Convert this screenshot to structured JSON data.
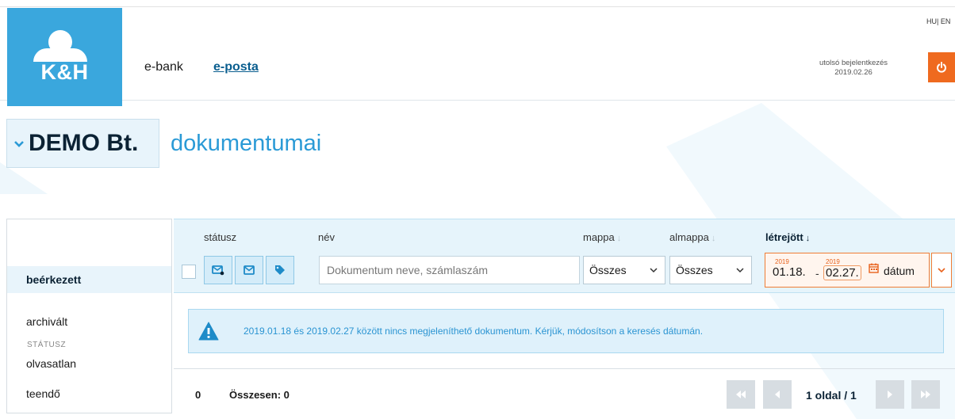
{
  "header": {
    "brand": "K&H",
    "nav": {
      "ebank": "e-bank",
      "eposta": "e-posta"
    },
    "lang": "HU| EN",
    "last_login_label": "utolsó bejelentkezés",
    "last_login_date": "2019.02.26"
  },
  "title": {
    "company": "DEMO Bt.",
    "suffix": "dokumentumai"
  },
  "sidebar": {
    "items": [
      {
        "label": "beérkezett",
        "active": true
      },
      {
        "label": "archivált",
        "active": false
      }
    ],
    "section_label": "STÁTUSZ",
    "status_items": [
      {
        "label": "olvasatlan"
      },
      {
        "label": "teendő"
      }
    ]
  },
  "columns": {
    "status": "státusz",
    "name": "név",
    "folder": "mappa",
    "subfolder": "almappa",
    "created": "létrejött",
    "sort_arrow": "↓"
  },
  "filters": {
    "name_placeholder": "Dokumentum neve, számlaszám",
    "folder_value": "Összes",
    "subfolder_value": "Összes",
    "date_from_year": "2019",
    "date_from": "01.18.",
    "date_sep": "-",
    "date_to_year": "2019",
    "date_to": "02.27.",
    "date_label": "dátum"
  },
  "message": "2019.01.18 és 2019.02.27 között nincs megjeleníthető dokumentum. Kérjük, módosítson a keresés dátumán.",
  "footer": {
    "count": "0",
    "total": "Összesen: 0",
    "page_info": "1 oldal / 1"
  },
  "colors": {
    "brand_blue": "#3aa7dd",
    "accent_orange": "#ef6a1f",
    "panel_blue": "#e6f4fb"
  }
}
